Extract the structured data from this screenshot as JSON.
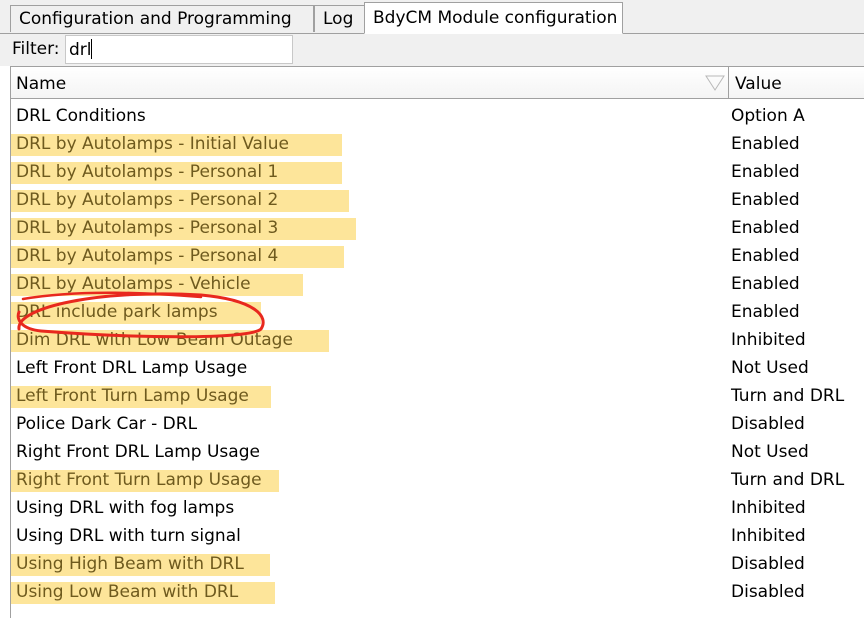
{
  "tabs": [
    {
      "label": "Configuration and Programming",
      "active": false
    },
    {
      "label": "Log",
      "active": false
    },
    {
      "label": "BdyCM Module configuration",
      "active": true
    }
  ],
  "filter": {
    "label": "Filter:",
    "value": "drl"
  },
  "table": {
    "columns": {
      "name": "Name",
      "value": "Value"
    },
    "rows": [
      {
        "name": "DRL Conditions",
        "value": "Option A",
        "highlighted": false
      },
      {
        "name": "DRL by Autolamps - Initial Value",
        "value": "Enabled",
        "highlighted": true
      },
      {
        "name": "DRL by Autolamps - Personal 1",
        "value": "Enabled",
        "highlighted": true
      },
      {
        "name": "DRL by Autolamps - Personal 2",
        "value": "Enabled",
        "highlighted": true
      },
      {
        "name": "DRL by Autolamps - Personal 3",
        "value": "Enabled",
        "highlighted": true
      },
      {
        "name": "DRL by Autolamps - Personal 4",
        "value": "Enabled",
        "highlighted": true
      },
      {
        "name": "DRL by Autolamps - Vehicle",
        "value": "Enabled",
        "highlighted": true
      },
      {
        "name": "DRL include park lamps",
        "value": "Enabled",
        "highlighted": true,
        "circled": true
      },
      {
        "name": "Dim DRL with Low Beam Outage",
        "value": "Inhibited",
        "highlighted": true
      },
      {
        "name": "Left Front DRL Lamp Usage",
        "value": "Not Used",
        "highlighted": false
      },
      {
        "name": "Left Front Turn Lamp Usage",
        "value": "Turn and DRL",
        "highlighted": true
      },
      {
        "name": "Police Dark Car - DRL",
        "value": "Disabled",
        "highlighted": false
      },
      {
        "name": "Right Front DRL Lamp Usage",
        "value": "Not Used",
        "highlighted": false
      },
      {
        "name": "Right Front Turn Lamp Usage",
        "value": "Turn and DRL",
        "highlighted": true
      },
      {
        "name": "Using DRL with fog lamps",
        "value": "Inhibited",
        "highlighted": false
      },
      {
        "name": "Using DRL with turn signal",
        "value": "Inhibited",
        "highlighted": false
      },
      {
        "name": "Using High Beam with DRL",
        "value": "Disabled",
        "highlighted": true
      },
      {
        "name": "Using Low Beam with DRL",
        "value": "Disabled",
        "highlighted": true
      }
    ]
  },
  "colors": {
    "highlight": "#fde59a",
    "annotation": "#e8281e"
  }
}
